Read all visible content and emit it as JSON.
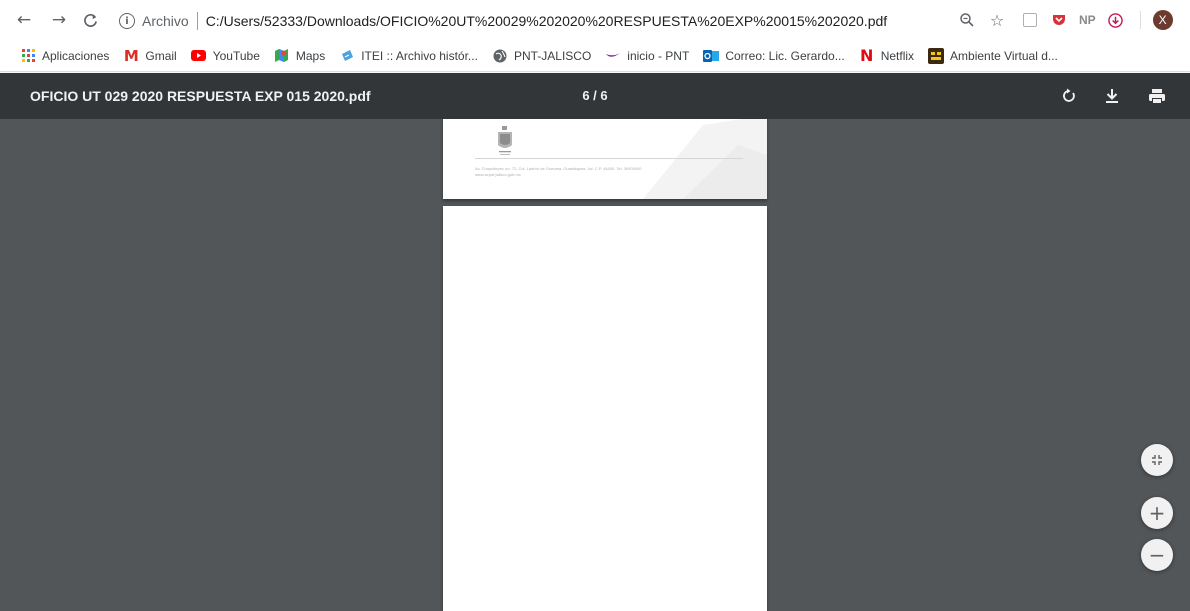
{
  "browser": {
    "url_scheme": "Archivo",
    "url": "C:/Users/52333/Downloads/OFICIO%20UT%20029%202020%20RESPUESTA%20EXP%20015%202020.pdf",
    "profile_initial": "X",
    "ext_np_label": "NP",
    "icons": [
      "back-icon",
      "forward-icon",
      "reload-icon",
      "info-icon",
      "zoom-icon",
      "star-icon"
    ]
  },
  "bookmarks": [
    {
      "label": "Aplicaciones",
      "icon": "apps-grid-icon"
    },
    {
      "label": "Gmail",
      "icon": "gmail-icon"
    },
    {
      "label": "YouTube",
      "icon": "youtube-icon"
    },
    {
      "label": "Maps",
      "icon": "maps-icon"
    },
    {
      "label": "ITEI :: Archivo histór...",
      "icon": "itei-icon"
    },
    {
      "label": "PNT-JALISCO",
      "icon": "globe-icon"
    },
    {
      "label": "inicio - PNT",
      "icon": "pnt-icon"
    },
    {
      "label": "Correo: Lic. Gerardo...",
      "icon": "outlook-icon"
    },
    {
      "label": "Netflix",
      "icon": "netflix-icon"
    },
    {
      "label": "Ambiente Virtual d...",
      "icon": "ambiente-icon"
    }
  ],
  "pdf": {
    "title": "OFICIO UT 029 2020 RESPUESTA EXP 015 2020.pdf",
    "page_indicator": "6 / 6",
    "footer_address": "Av. Chapultepec no. 72, Col. Ladrón de Guevara, Guadalajara, Jal. C.P. 44600, Tel. 30905000",
    "footer_web": "www.sepaf.jalisco.gob.mx",
    "toolbar_icons": [
      "rotate-icon",
      "download-icon",
      "print-icon"
    ],
    "zoom_controls": [
      "fit-page-icon",
      "zoom-in-icon",
      "zoom-out-icon"
    ]
  },
  "colors": {
    "toolbar": "#323639",
    "viewer_bg": "#525659",
    "page": "#ffffff",
    "profile": "#6d3a2f"
  }
}
